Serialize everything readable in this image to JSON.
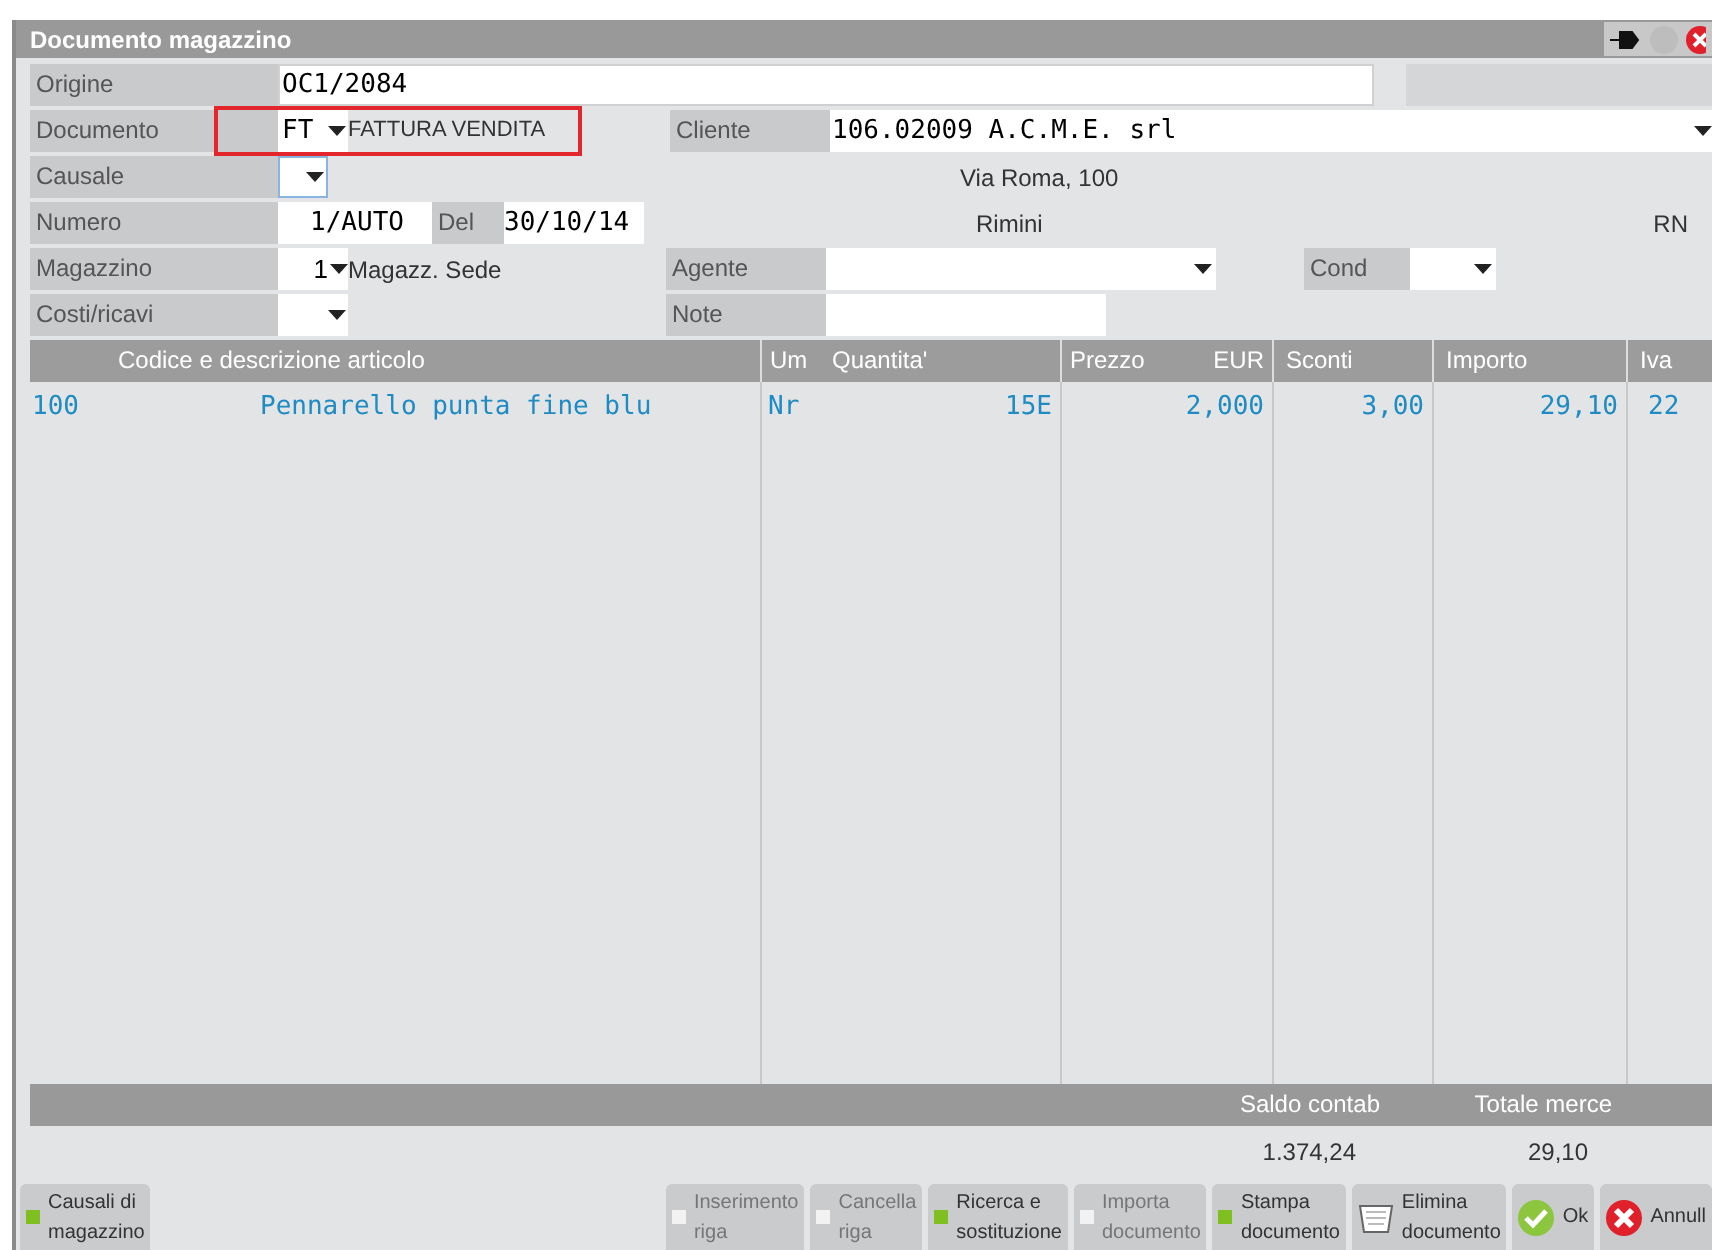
{
  "window": {
    "title": "Documento magazzino"
  },
  "form": {
    "origine": {
      "label": "Origine",
      "value": "OC1/2084"
    },
    "documento": {
      "label": "Documento",
      "code": "FT",
      "description": "FATTURA VENDITA",
      "highlighted": true
    },
    "cliente": {
      "label": "Cliente",
      "value": "106.02009 A.C.M.E. srl",
      "address": "Via Roma, 100",
      "city": "Rimini",
      "province": "RN"
    },
    "causale": {
      "label": "Causale"
    },
    "numero": {
      "label": "Numero",
      "value": "1/AUTO",
      "del_label": "Del",
      "date": "30/10/14"
    },
    "magazzino": {
      "label": "Magazzino",
      "value": "1",
      "description": "Magazz. Sede"
    },
    "agente": {
      "label": "Agente"
    },
    "cond": {
      "label": "Cond"
    },
    "costi": {
      "label": "Costi/ricavi"
    },
    "note": {
      "label": "Note"
    }
  },
  "table": {
    "columns": [
      "Codice e descrizione articolo",
      "Um",
      "Quantita'",
      "Prezzo",
      "EUR",
      "Sconti",
      "Importo",
      "Iva"
    ],
    "rows": [
      {
        "code": "100",
        "description": "Pennarello punta fine blu",
        "um": "Nr",
        "quantity": "15E",
        "price": "2,000",
        "discount": "3,00",
        "amount": "29,10",
        "vat": "22"
      }
    ]
  },
  "totals": [
    {
      "label": "Saldo contab",
      "value": "1.374,24"
    },
    {
      "label": "Totale merce",
      "value": "29,10"
    }
  ],
  "buttons": [
    {
      "kind": "square",
      "lines": [
        "Causali di",
        "magazzino"
      ],
      "disabled": false
    },
    {
      "kind": "square",
      "lines": [
        "Inserimento",
        "riga"
      ],
      "disabled": true
    },
    {
      "kind": "square",
      "lines": [
        "Cancella",
        "riga"
      ],
      "disabled": true
    },
    {
      "kind": "square",
      "lines": [
        "Ricerca e",
        "sostituzione"
      ],
      "disabled": false
    },
    {
      "kind": "square",
      "lines": [
        "Importa",
        "documento"
      ],
      "disabled": true
    },
    {
      "kind": "square",
      "lines": [
        "Stampa",
        "documento"
      ],
      "disabled": false
    },
    {
      "kind": "trash",
      "lines": [
        "Elimina",
        "documento"
      ],
      "disabled": false
    },
    {
      "kind": "ok",
      "lines": [
        "Ok"
      ],
      "disabled": false
    },
    {
      "kind": "cancel",
      "lines": [
        "Annull"
      ],
      "disabled": false
    }
  ]
}
